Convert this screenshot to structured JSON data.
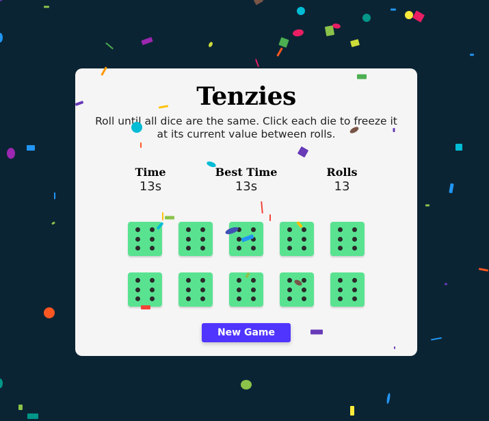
{
  "game": {
    "title": "Tenzies",
    "instructions": "Roll until all dice are the same. Click each die to freeze it at its current value between rolls.",
    "stats": [
      {
        "label": "Time",
        "value": "13s"
      },
      {
        "label": "Best Time",
        "value": "13s"
      },
      {
        "label": "Rolls",
        "value": "13"
      }
    ],
    "dice": [
      {
        "value": 6,
        "held": true
      },
      {
        "value": 6,
        "held": true
      },
      {
        "value": 6,
        "held": true
      },
      {
        "value": 6,
        "held": true
      },
      {
        "value": 6,
        "held": true
      },
      {
        "value": 6,
        "held": true
      },
      {
        "value": 6,
        "held": true
      },
      {
        "value": 6,
        "held": true
      },
      {
        "value": 6,
        "held": true
      },
      {
        "value": 6,
        "held": true
      }
    ],
    "new_game_label": "New Game"
  },
  "colors": {
    "background": "#0b2434",
    "card": "#f5f5f5",
    "die_held": "#59e391",
    "pip": "#2b2b2b",
    "button": "#5035ff",
    "confetti": [
      "#f44336",
      "#e91e63",
      "#9c27b0",
      "#673ab7",
      "#3f51b5",
      "#2196f3",
      "#03a9f4",
      "#00bcd4",
      "#009688",
      "#4caf50",
      "#8bc34a",
      "#cddc39",
      "#ffeb3b",
      "#ffc107",
      "#ff9800",
      "#ff5722",
      "#795548"
    ]
  }
}
